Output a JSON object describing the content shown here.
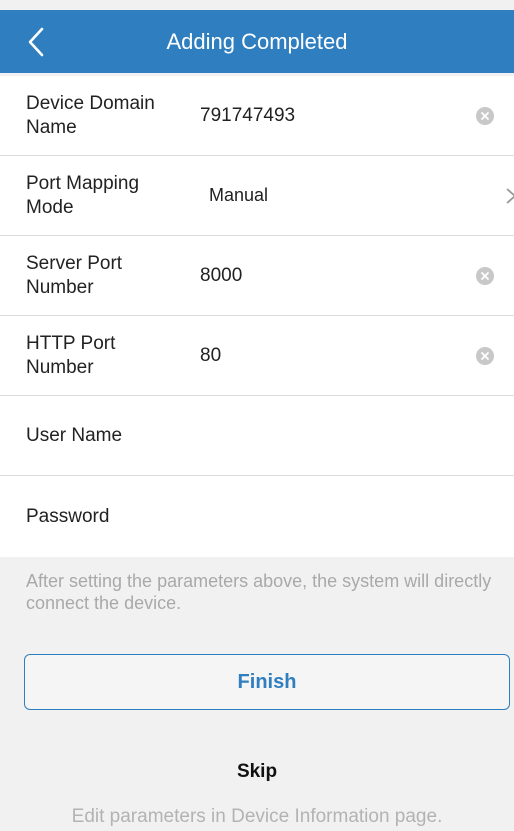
{
  "header": {
    "title": "Adding Completed"
  },
  "form": {
    "rows": [
      {
        "label": "Device Domain Name",
        "value": "791747493"
      },
      {
        "label": "Port Mapping Mode",
        "value": "Manual"
      },
      {
        "label": "Server Port Number",
        "value": "8000"
      },
      {
        "label": "HTTP Port Number",
        "value": "80"
      },
      {
        "label": "User Name",
        "value": ""
      },
      {
        "label": "Password",
        "value": ""
      }
    ]
  },
  "hint": "After setting the parameters above, the system will directly connect the device.",
  "buttons": {
    "finish": "Finish",
    "skip": "Skip"
  },
  "footnote": "Edit parameters in Device Information page.",
  "colors": {
    "accent": "#2f7fc0",
    "background": "#f1f1f1"
  }
}
